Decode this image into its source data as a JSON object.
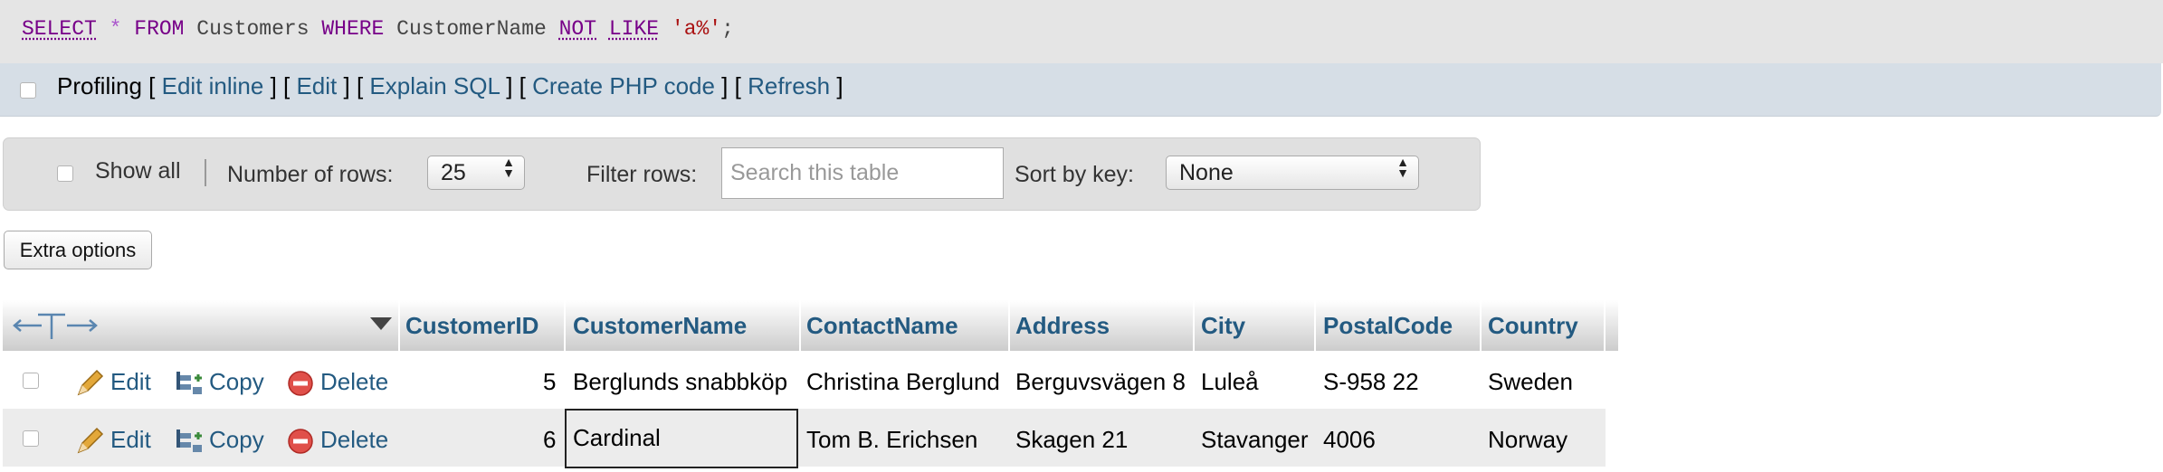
{
  "sql": {
    "select": "SELECT",
    "star": "*",
    "from": "FROM",
    "table": "Customers",
    "where": "WHERE",
    "column": "CustomerName",
    "not": "NOT",
    "like": "LIKE",
    "pattern": "'a%'",
    "semicolon": ";"
  },
  "profiling": {
    "label": "Profiling",
    "links": [
      "Edit inline",
      "Edit",
      "Explain SQL",
      "Create PHP code",
      "Refresh"
    ]
  },
  "navigation": {
    "show_all": "Show all",
    "rows_label": "Number of rows:",
    "rows_value": "25",
    "filter_label": "Filter rows:",
    "filter_placeholder": "Search this table",
    "sort_label": "Sort by key:",
    "sort_value": "None"
  },
  "extra_options": "Extra options",
  "table": {
    "columns": [
      "CustomerID",
      "CustomerName",
      "ContactName",
      "Address",
      "City",
      "PostalCode",
      "Country"
    ],
    "actions": {
      "edit": "Edit",
      "copy": "Copy",
      "delete": "Delete"
    },
    "rows": [
      {
        "CustomerID": "5",
        "CustomerName": "Berglunds snabbköp",
        "ContactName": "Christina Berglund",
        "Address": "Berguvsvägen 8",
        "City": "Luleå",
        "PostalCode": "S-958 22",
        "Country": "Sweden"
      },
      {
        "CustomerID": "6",
        "CustomerName": "Cardinal",
        "ContactName": "Tom B. Erichsen",
        "Address": "Skagen 21",
        "City": "Stavanger",
        "PostalCode": "4006",
        "Country": "Norway"
      }
    ]
  },
  "colors": {
    "link": "#235a81",
    "keyword": "#770088",
    "string": "#aa1111",
    "delete_icon": "#e0504a",
    "pencil_icon": "#e3a83a"
  }
}
